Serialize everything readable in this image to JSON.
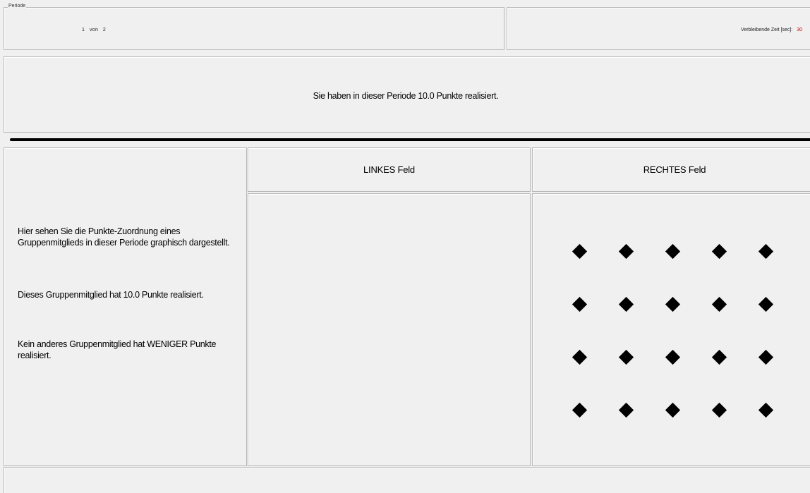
{
  "period": {
    "legend": "Periode",
    "current": "1",
    "separator": "von",
    "total": "2"
  },
  "timer": {
    "label": "Verbleibende Zeit [sec]:",
    "value": "30",
    "value_color": "#d00000"
  },
  "message": "Sie haben in dieser Periode 10.0 Punkte realisiert.",
  "info": {
    "line1": "Hier sehen Sie die Punkte-Zuordnung eines Gruppenmitglieds in dieser Periode graphisch dargestellt.",
    "line2": "Dieses Gruppenmitglied hat 10.0 Punkte realisiert.",
    "line3": "Kein anderes Gruppenmitglied hat WENIGER Punkte realisiert."
  },
  "fields": {
    "left_label": "LINKES Feld",
    "right_label": "RECHTES Feld",
    "left_points": 0,
    "right_points": 20
  },
  "colors": {
    "background": "#f0f0f0",
    "point": "#000000"
  }
}
